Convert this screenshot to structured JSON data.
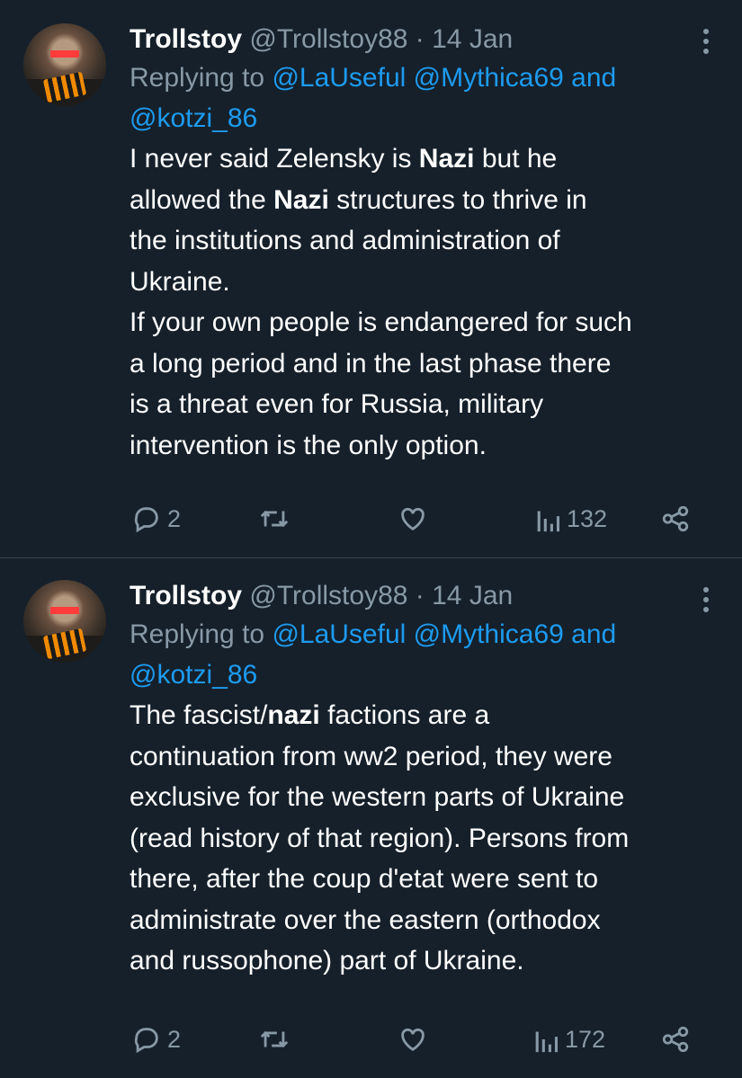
{
  "tweets": [
    {
      "display_name": "Trollstoy",
      "handle": "@Trollstoy88",
      "separator": "·",
      "date": "14 Jan",
      "replying_to_label": "Replying to",
      "mentions": [
        "@LaUseful",
        "@Mythica69"
      ],
      "mentions_joiner": "and",
      "last_mention": "@kotzi_86",
      "body": {
        "line1_a": "I never said Zelensky is ",
        "line1_b": "Nazi",
        "line1_c": " but he",
        "line2_a": "allowed the ",
        "line2_b": "Nazi",
        "line2_c": " structures to thrive in",
        "line3": "the institutions and administration of",
        "line4": "Ukraine.",
        "line5": "If your own people is endangered for such",
        "line6": "a long period and in the last phase there",
        "line7": "is a threat even for Russia, military",
        "line8": "intervention is the only option."
      },
      "replies": "2",
      "views": "132"
    },
    {
      "display_name": "Trollstoy",
      "handle": "@Trollstoy88",
      "separator": "·",
      "date": "14 Jan",
      "replying_to_label": "Replying to",
      "mentions": [
        "@LaUseful",
        "@Mythica69"
      ],
      "mentions_joiner": "and",
      "last_mention": "@kotzi_86",
      "body": {
        "line1_a": "The fascist/",
        "line1_b": "nazi",
        "line1_c": " factions are a",
        "line2": "continuation from ww2 period, they were",
        "line3": "exclusive for the western parts of Ukraine",
        "line4": "(read history of that region). Persons from",
        "line5": "there, after the coup d'etat were sent to",
        "line6": "administrate over the eastern (orthodox",
        "line7": "and russophone) part of Ukraine."
      },
      "replies": "2",
      "views": "172"
    }
  ],
  "icons": {
    "reply": "comment-bubble-icon",
    "retweet": "retweet-icon",
    "like": "heart-icon",
    "views": "bar-chart-icon",
    "share": "share-icon",
    "more": "more-vertical-icon"
  },
  "colors": {
    "background": "#15202b",
    "text": "#ffffff",
    "muted": "#8899a6",
    "link": "#1d9bf0",
    "divider": "#38444d"
  }
}
